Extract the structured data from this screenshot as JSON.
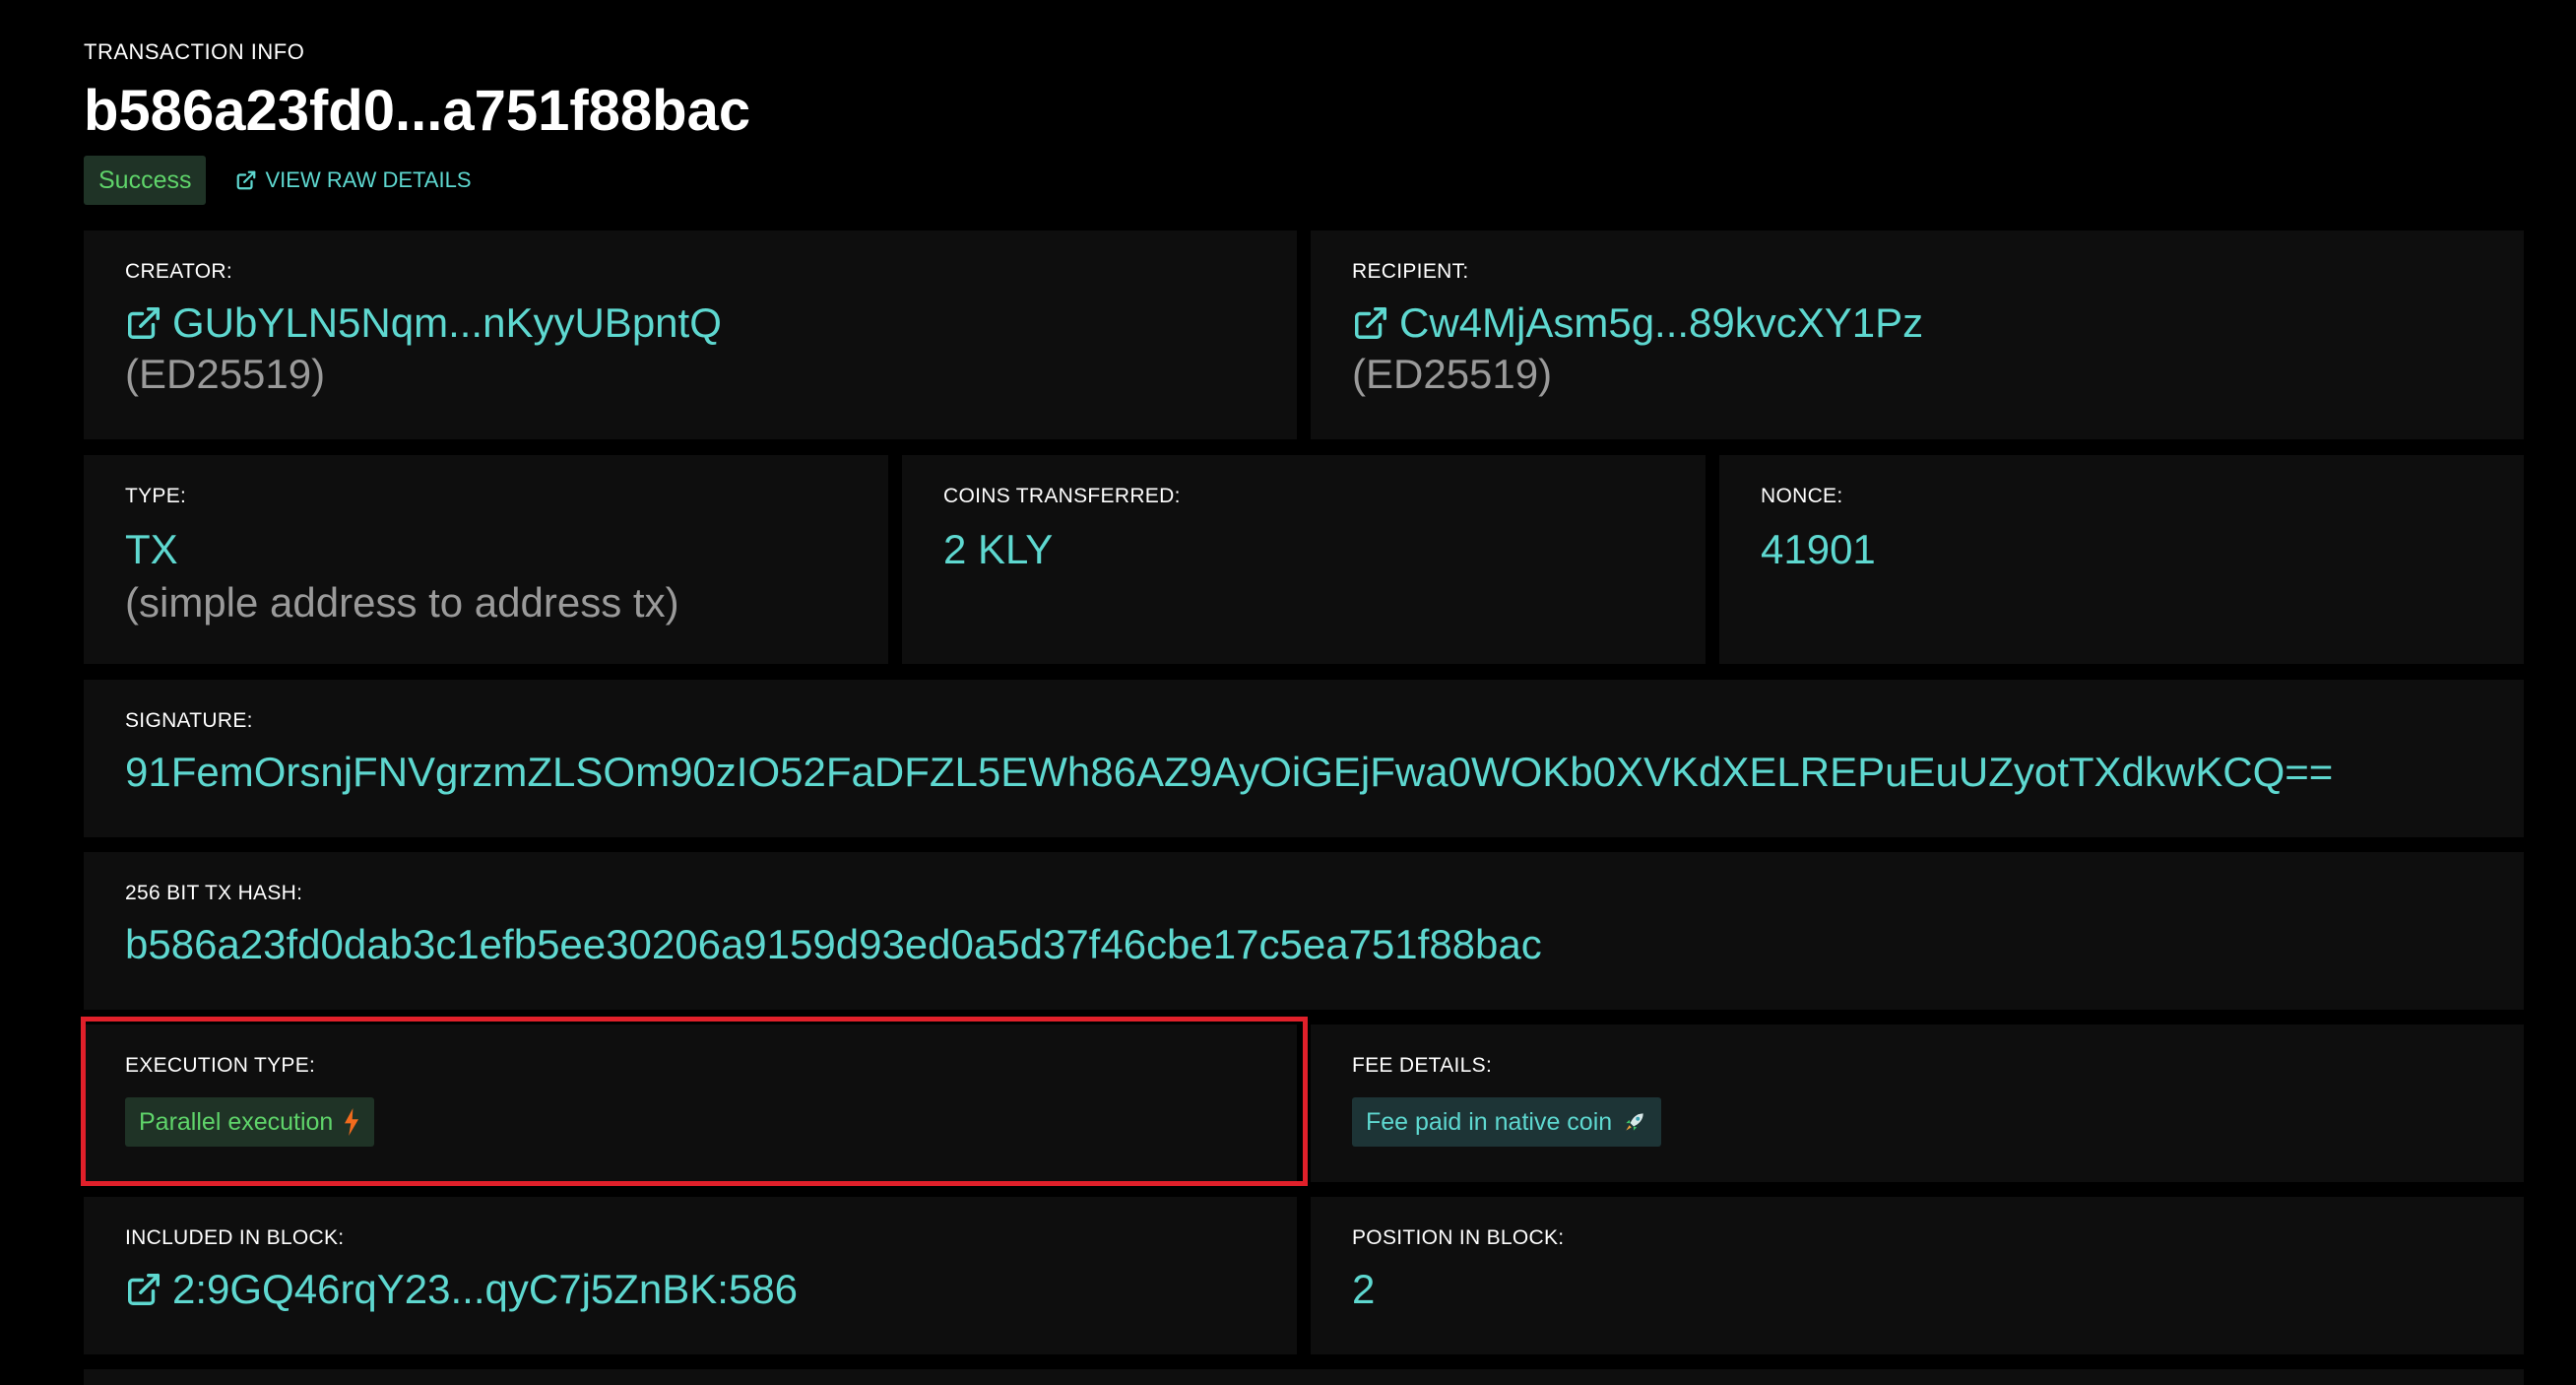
{
  "header": {
    "eyebrow": "TRANSACTION INFO",
    "title": "b586a23fd0...a751f88bac",
    "status_badge": "Success",
    "raw_details_link": "VIEW RAW DETAILS"
  },
  "creator": {
    "label": "CREATOR:",
    "address": "GUbYLN5Nqm...nKyyUBpntQ",
    "key_type": "(ED25519)"
  },
  "recipient": {
    "label": "RECIPIENT:",
    "address": "Cw4MjAsm5g...89kvcXY1Pz",
    "key_type": "(ED25519)"
  },
  "type": {
    "label": "TYPE:",
    "value": "TX",
    "description": "(simple address to address tx)"
  },
  "coins_transferred": {
    "label": "COINS TRANSFERRED:",
    "value": "2 KLY"
  },
  "nonce": {
    "label": "NONCE:",
    "value": "41901"
  },
  "signature": {
    "label": "SIGNATURE:",
    "value": "91FemOrsnjFNVgrzmZLSOm90zIO52FaDFZL5EWh86AZ9AyOiGEjFwa0WOKb0XVKdXELREPuEuUZyotTXdkwKCQ=="
  },
  "tx_hash": {
    "label": "256 BIT TX HASH:",
    "value": "b586a23fd0dab3c1efb5ee30206a9159d93ed0a5d37f46cbe17c5ea751f88bac"
  },
  "execution_type": {
    "label": "EXECUTION TYPE:",
    "value": "Parallel execution",
    "icon": "lightning-icon"
  },
  "fee_details": {
    "label": "FEE DETAILS:",
    "value": "Fee paid in native coin",
    "icon": "rocket-icon"
  },
  "included_in_block": {
    "label": "INCLUDED IN BLOCK:",
    "value": "2:9GQ46rqY23...qyC7j5ZnBK:586"
  },
  "position_in_block": {
    "label": "POSITION IN BLOCK:",
    "value": "2"
  },
  "colors": {
    "accent": "#5ed8d0",
    "success": "#5fd46a",
    "card_bg": "#0e0e0e",
    "highlight": "#e0202a"
  }
}
